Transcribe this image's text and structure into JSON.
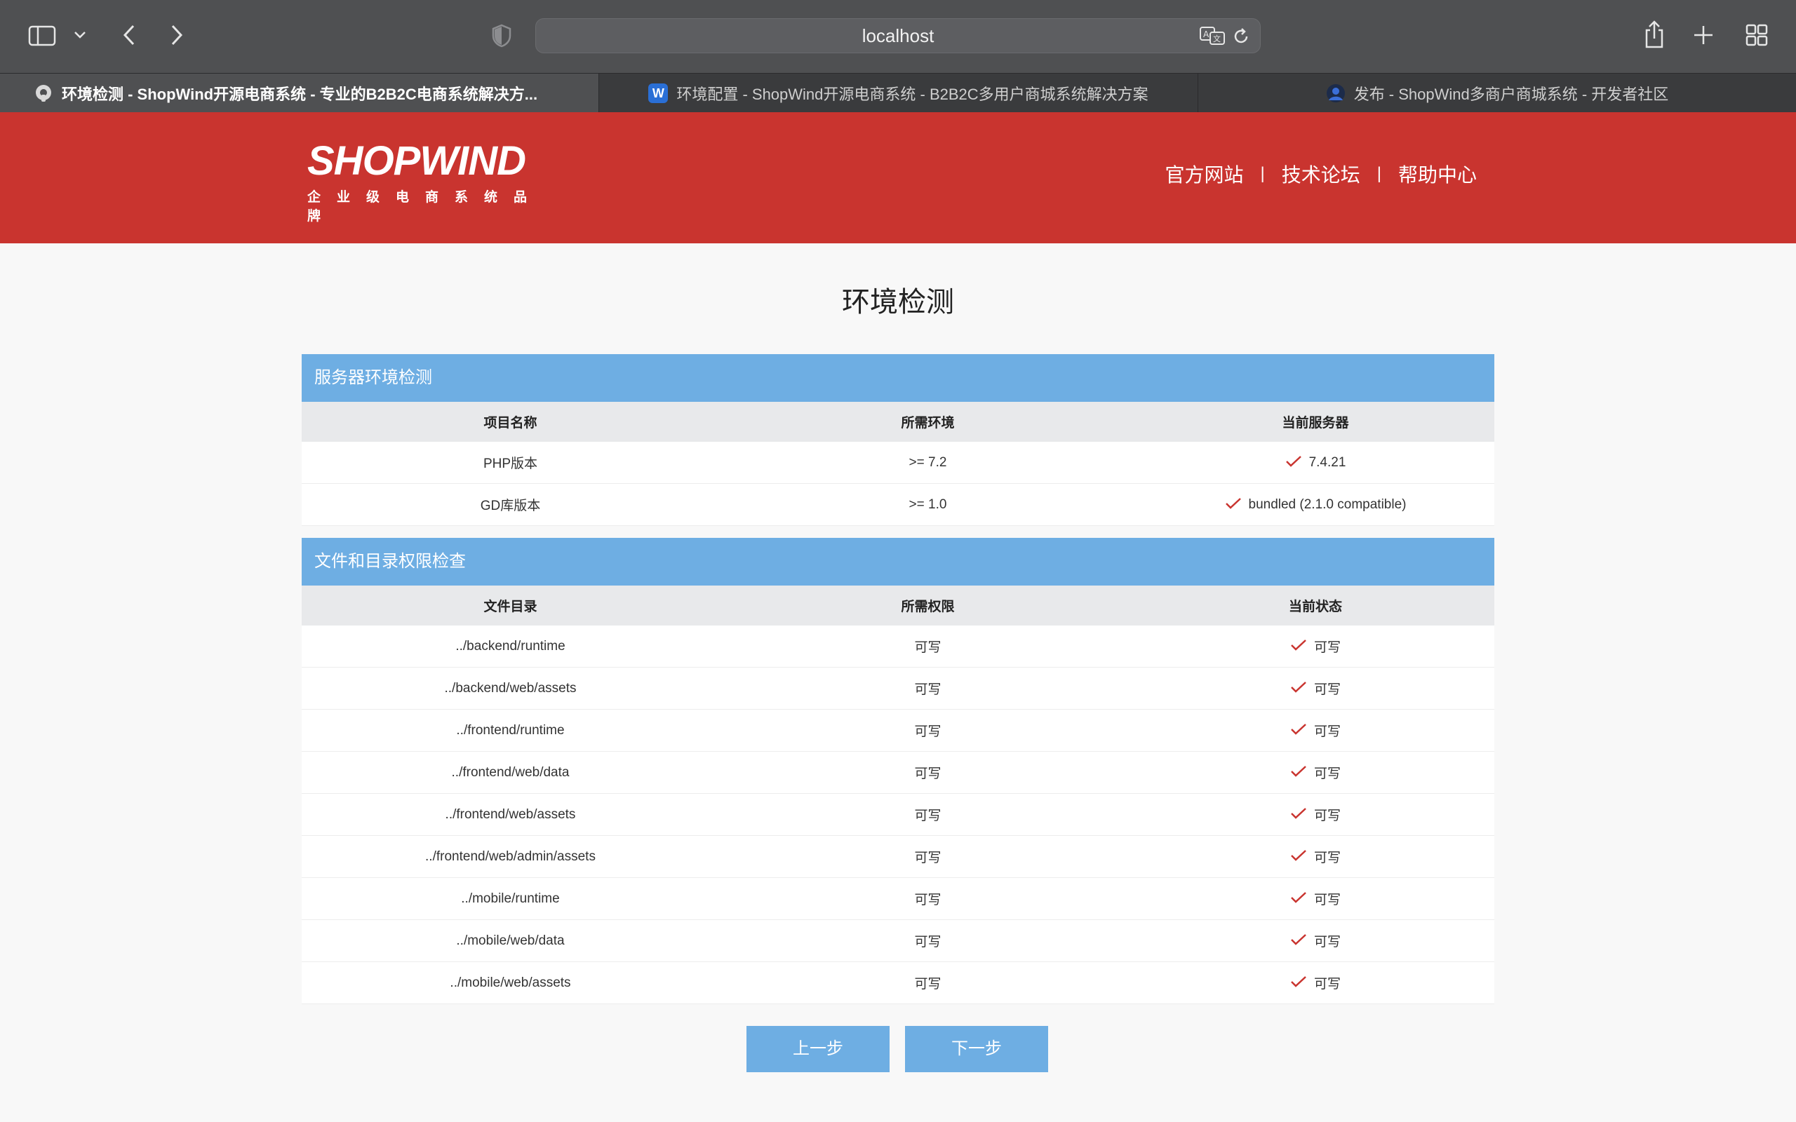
{
  "browser": {
    "url": "localhost",
    "tabs": [
      {
        "label": "环境检测 - ShopWind开源电商系统 - 专业的B2B2C电商系统解决方...",
        "favicon": "elephant-icon",
        "active": true
      },
      {
        "label": "环境配置 - ShopWind开源电商系统 - B2B2C多用户商城系统解决方案",
        "favicon": "W",
        "active": false
      },
      {
        "label": "发布 - ShopWind多商户商城系统 - 开发者社区",
        "favicon": "avatar-icon",
        "active": false
      }
    ]
  },
  "header": {
    "logo_main": "SHOPWIND",
    "logo_sub": "企业级电商系统品牌",
    "nav": [
      "官方网站",
      "技术论坛",
      "帮助中心"
    ],
    "nav_separator": "|",
    "color": "#c9342f"
  },
  "page_title": "环境检测",
  "server_check": {
    "title": "服务器环境检测",
    "columns": [
      "项目名称",
      "所需环境",
      "当前服务器"
    ],
    "rows": [
      {
        "name": "PHP版本",
        "required": ">= 7.2",
        "current": "7.4.21"
      },
      {
        "name": "GD库版本",
        "required": ">= 1.0",
        "current": "bundled (2.1.0 compatible)"
      }
    ]
  },
  "file_check": {
    "title": "文件和目录权限检查",
    "columns": [
      "文件目录",
      "所需权限",
      "当前状态"
    ],
    "rows": [
      {
        "path": "../backend/runtime",
        "required": "可写",
        "status": "可写"
      },
      {
        "path": "../backend/web/assets",
        "required": "可写",
        "status": "可写"
      },
      {
        "path": "../frontend/runtime",
        "required": "可写",
        "status": "可写"
      },
      {
        "path": "../frontend/web/data",
        "required": "可写",
        "status": "可写"
      },
      {
        "path": "../frontend/web/assets",
        "required": "可写",
        "status": "可写"
      },
      {
        "path": "../frontend/web/admin/assets",
        "required": "可写",
        "status": "可写"
      },
      {
        "path": "../mobile/runtime",
        "required": "可写",
        "status": "可写"
      },
      {
        "path": "../mobile/web/data",
        "required": "可写",
        "status": "可写"
      },
      {
        "path": "../mobile/web/assets",
        "required": "可写",
        "status": "可写"
      }
    ]
  },
  "buttons": {
    "prev": "上一步",
    "next": "下一步"
  },
  "colors": {
    "accent": "#6eaee3",
    "check": "#c9342f"
  }
}
